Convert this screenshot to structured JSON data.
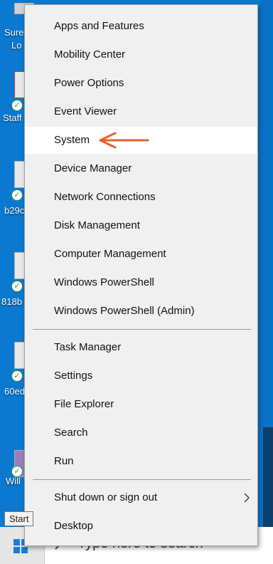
{
  "desktop": {
    "icons": [
      {
        "label": "Sure",
        "label2": "Lo"
      },
      {
        "label": "Staff"
      },
      {
        "label": "b29c"
      },
      {
        "label": "818b"
      },
      {
        "label": "60ed"
      },
      {
        "label": "Will"
      }
    ]
  },
  "context_menu": {
    "group1": [
      "Apps and Features",
      "Mobility Center",
      "Power Options",
      "Event Viewer",
      "System",
      "Device Manager",
      "Network Connections",
      "Disk Management",
      "Computer Management",
      "Windows PowerShell",
      "Windows PowerShell (Admin)"
    ],
    "group2": [
      "Task Manager",
      "Settings",
      "File Explorer",
      "Search",
      "Run"
    ],
    "group3": [
      "Shut down or sign out",
      "Desktop"
    ],
    "highlighted": "System",
    "arrow_color": "#e8632c"
  },
  "taskbar": {
    "start_tooltip": "Start",
    "search_placeholder": "Type here to search"
  }
}
